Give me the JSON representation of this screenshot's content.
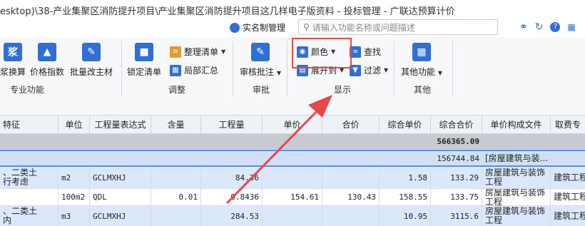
{
  "window": {
    "title": "esktop)\\38-产业集聚区消防提升项目\\产业集聚区消防提升项目这几样电子版资料 - 投标管理 - 广联达预算计价"
  },
  "subbar": {
    "realname_label": "实名制管理",
    "search_placeholder": "请输入功能名称或问题描述"
  },
  "ribbon": {
    "groups": [
      {
        "label": "专业功能",
        "buttons": [
          "浆换算",
          "价格指数",
          "批量改主材"
        ]
      },
      {
        "label": "调整",
        "big_button": "锁定清单",
        "small_buttons": [
          "整理清单",
          "局部汇总"
        ]
      },
      {
        "label": "审批",
        "big_button": "审核批注"
      },
      {
        "label": "显示",
        "small_buttons": [
          "颜色",
          "查找",
          "展开到",
          "过滤"
        ]
      },
      {
        "label": "其他",
        "big_button": "其他功能"
      }
    ]
  },
  "table": {
    "columns": [
      "特征",
      "单位",
      "工程量表达式",
      "含量",
      "工程量",
      "单价",
      "合价",
      "综合单价",
      "综合合价",
      "单价构成文件",
      "取费专"
    ],
    "total_row": {
      "composite_total": "566365.09"
    },
    "section_row": {
      "composite_total": "156744.84",
      "file": "[房屋建筑与装..."
    },
    "rows": [
      {
        "feature": "、二类土\n行考虑",
        "unit": "m2",
        "expr": "GCLMXHJ",
        "content": "",
        "quantity": "84.36",
        "price": "",
        "amount": "",
        "unit_composite": "1.58",
        "composite_total": "133.29",
        "file": "房屋建筑与装饰\n工程",
        "fee": "建筑工程"
      },
      {
        "feature": "",
        "unit": "100m2",
        "expr": "QDL",
        "content": "0.01",
        "quantity": "0.8436",
        "price": "154.61",
        "amount": "130.43",
        "unit_composite": "158.55",
        "composite_total": "133.75",
        "file": "房屋建筑与装饰\n工程",
        "fee": "建筑工程"
      },
      {
        "feature": "、二类土\n内",
        "unit": "m3",
        "expr": "GCLMXHJ",
        "content": "",
        "quantity": "284.53",
        "price": "",
        "amount": "",
        "unit_composite": "10.95",
        "composite_total": "3115.6",
        "file": "房屋建筑与装饰\n工程",
        "fee": "建筑工程"
      }
    ]
  },
  "colors": {
    "accent_blue": "#2f6fd6",
    "highlight_red": "#e84848",
    "row_selected": "#dbe8fb"
  }
}
